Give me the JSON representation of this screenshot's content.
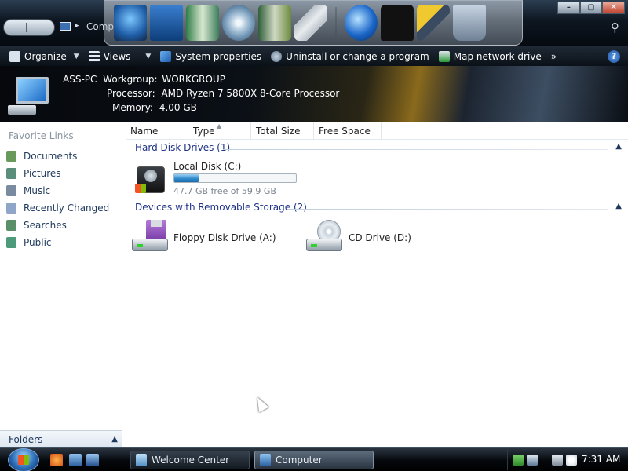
{
  "window": {
    "address": "Compu",
    "controls": {
      "minimize": "–",
      "maximize": "▢",
      "close": "✕"
    }
  },
  "dock": {
    "items": [
      "monitor-icon",
      "screen-icon",
      "book-icon",
      "cd-icon",
      "book-icon",
      "tools-icon",
      "globe-icon",
      "shirt-icon",
      "tools-icon",
      "recycle-bin-icon"
    ]
  },
  "toolbar": {
    "organize": "Organize",
    "views": "Views",
    "system_properties": "System properties",
    "uninstall": "Uninstall or change a program",
    "map_drive": "Map network drive",
    "more": "»",
    "help": "?"
  },
  "info": {
    "computer_name": "ASS-PC",
    "workgroup_label": "Workgroup:",
    "workgroup": "WORKGROUP",
    "processor_label": "Processor:",
    "processor": "AMD Ryzen 7 5800X 8-Core Processor",
    "memory_label": "Memory:",
    "memory": "4.00 GB"
  },
  "sidebar": {
    "title": "Favorite Links",
    "items": [
      {
        "label": "Documents",
        "color": "#6a9a5a"
      },
      {
        "label": "Pictures",
        "color": "#5a8e7a"
      },
      {
        "label": "Music",
        "color": "#7a8aa0"
      },
      {
        "label": "Recently Changed",
        "color": "#8fa6c8"
      },
      {
        "label": "Searches",
        "color": "#5b8f6a"
      },
      {
        "label": "Public",
        "color": "#4d9a7a"
      }
    ],
    "folders": "Folders"
  },
  "columns": [
    "Name",
    "Type",
    "Total Size",
    "Free Space"
  ],
  "groups": {
    "hard_disks": {
      "title": "Hard Disk Drives (1)",
      "drives": [
        {
          "name": "Local Disk (C:)",
          "free_text": "47.7 GB free of 59.9 GB",
          "used_fraction": 0.2
        }
      ]
    },
    "removable": {
      "title": "Devices with Removable Storage (2)",
      "drives": [
        {
          "name": "Floppy Disk Drive (A:)"
        },
        {
          "name": "CD Drive (D:)"
        }
      ]
    }
  },
  "taskbar": {
    "tasks": [
      {
        "label": "Welcome Center",
        "active": false
      },
      {
        "label": "Computer",
        "active": true
      }
    ],
    "clock": "7:31 AM"
  }
}
